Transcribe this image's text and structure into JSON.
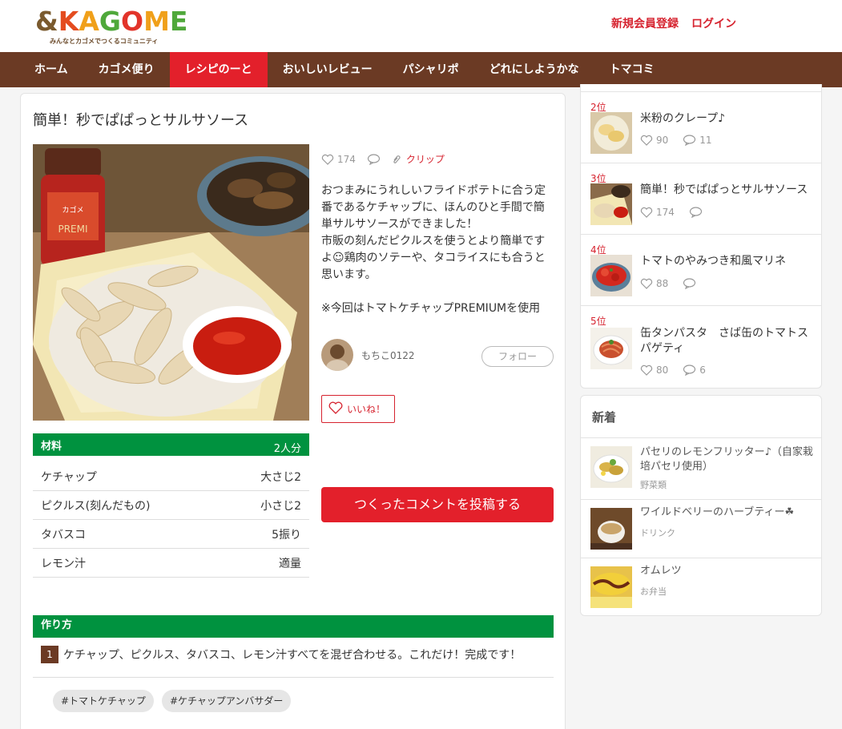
{
  "logo": {
    "main_amp": "&",
    "main_k": "K",
    "main_a": "A",
    "main_g": "G",
    "main_o": "O",
    "main_m": "M",
    "main_e": "E",
    "tagline": "みんなとカゴメでつくるコミュニティ"
  },
  "auth": {
    "register": "新規会員登録",
    "login": "ログイン"
  },
  "nav": [
    "ホーム",
    "カゴメ便り",
    "レシピのーと",
    "おいしいレビュー",
    "パシャリポ",
    "どれにしようかな",
    "トマコミ"
  ],
  "recipe": {
    "title": "簡単！秒でぱぱっとサルサソース",
    "likes": "174",
    "clip_label": "クリップ",
    "description": "おつまみにうれしいフライドポテトに合う定番であるケチャップに、ほんのひと手間で簡単サルサソースができました！\n市販の刻んだピクルスを使うとより簡単ですよ☺鶏肉のソテーや、タコライスにも合うと思います。\n\n※今回はトマトケチャップPREMIUMを使用",
    "author": "もちこ0122",
    "follow_label": "フォロー",
    "like_button": "いいね！",
    "post_comment": "つくったコメントを投稿する",
    "ingredients_label": "材料",
    "servings": "2人分",
    "ingredients": [
      {
        "name": "ケチャップ",
        "amount": "大さじ2"
      },
      {
        "name": "ピクルス(刻んだもの)",
        "amount": "小さじ2"
      },
      {
        "name": "タバスコ",
        "amount": "5振り"
      },
      {
        "name": "レモン汁",
        "amount": "適量"
      }
    ],
    "steps_label": "作り方",
    "steps": [
      {
        "num": "1",
        "text": "ケチャップ、ピクルス、タバスコ、レモン汁すべてを混ぜ合わせる。これだけ！完成です！"
      }
    ],
    "tags": [
      "#トマトケチャップ",
      "#ケチャップアンバサダー"
    ]
  },
  "ranking": [
    {
      "rank": "2位",
      "title": "米粉のクレープ♪",
      "likes": "90",
      "comments": "11"
    },
    {
      "rank": "3位",
      "title": "簡単！秒でぱぱっとサルサソース",
      "likes": "174",
      "comments": ""
    },
    {
      "rank": "4位",
      "title": "トマトのやみつき和風マリネ",
      "likes": "88",
      "comments": ""
    },
    {
      "rank": "5位",
      "title": "缶タンパスタ　さば缶のトマトスパゲティ",
      "likes": "80",
      "comments": "6"
    }
  ],
  "new_section": {
    "title": "新着",
    "items": [
      {
        "title": "パセリのレモンフリッター♪（自家栽培パセリ使用）",
        "category": "野菜類"
      },
      {
        "title": "ワイルドベリーのハーブティー☘",
        "category": "ドリンク"
      },
      {
        "title": "オムレツ",
        "category": "お弁当"
      }
    ]
  },
  "colors": {
    "brand_brown": "#6b3a24",
    "accent_red": "#e3202b",
    "green": "#00923f"
  }
}
